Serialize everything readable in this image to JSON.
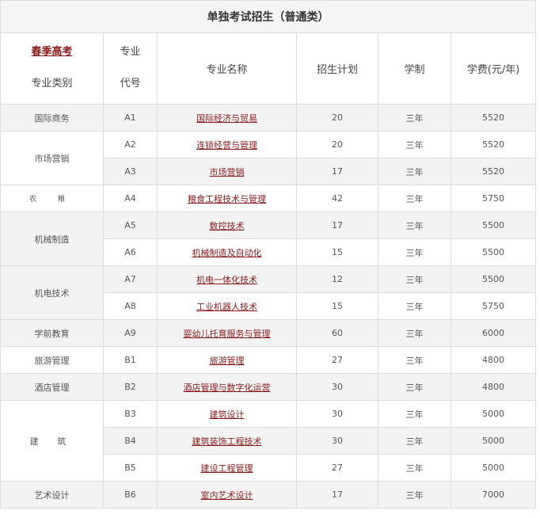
{
  "table": {
    "title": "单独考试招生（普通类）",
    "headers": {
      "spring_link": "春季高考",
      "category": "专业类别",
      "code_line1": "专业",
      "code_line2": "代号",
      "name": "专业名称",
      "plan": "招生计划",
      "duration": "学制",
      "fee": "学费(元/年)"
    },
    "categories": {
      "c1": "国际商务",
      "c2": "市场营销",
      "c3": "农  粮",
      "c4": "机械制造",
      "c5": "机电技术",
      "c6": "学前教育",
      "c7": "旅游管理",
      "c8": "酒店管理",
      "c9": "建  筑",
      "c10": "艺术设计"
    },
    "rows": [
      {
        "code": "A1",
        "name": "国际经济与贸易",
        "plan": "20",
        "duration": "三年",
        "fee": "5520"
      },
      {
        "code": "A2",
        "name": "连锁经营与管理",
        "plan": "20",
        "duration": "三年",
        "fee": "5520"
      },
      {
        "code": "A3",
        "name": "市场营销",
        "plan": "17",
        "duration": "三年",
        "fee": "5520"
      },
      {
        "code": "A4",
        "name": "粮食工程技术与管理",
        "plan": "42",
        "duration": "三年",
        "fee": "5750"
      },
      {
        "code": "A5",
        "name": "数控技术",
        "plan": "17",
        "duration": "三年",
        "fee": "5500"
      },
      {
        "code": "A6",
        "name": "机械制造及自动化",
        "plan": "15",
        "duration": "三年",
        "fee": "5500"
      },
      {
        "code": "A7",
        "name": "机电一体化技术",
        "plan": "12",
        "duration": "三年",
        "fee": "5500"
      },
      {
        "code": "A8",
        "name": "工业机器人技术",
        "plan": "15",
        "duration": "三年",
        "fee": "5750"
      },
      {
        "code": "A9",
        "name": "婴幼儿托育服务与管理",
        "plan": "60",
        "duration": "三年",
        "fee": "6000"
      },
      {
        "code": "B1",
        "name": "旅游管理",
        "plan": "27",
        "duration": "三年",
        "fee": "4800"
      },
      {
        "code": "B2",
        "name": "酒店管理与数字化运营",
        "plan": "30",
        "duration": "三年",
        "fee": "4800"
      },
      {
        "code": "B3",
        "name": "建筑设计",
        "plan": "30",
        "duration": "三年",
        "fee": "5000"
      },
      {
        "code": "B4",
        "name": "建筑装饰工程技术",
        "plan": "30",
        "duration": "三年",
        "fee": "5000"
      },
      {
        "code": "B5",
        "name": "建设工程管理",
        "plan": "27",
        "duration": "三年",
        "fee": "5000"
      },
      {
        "code": "B6",
        "name": "室内艺术设计",
        "plan": "17",
        "duration": "三年",
        "fee": "7000"
      }
    ]
  }
}
